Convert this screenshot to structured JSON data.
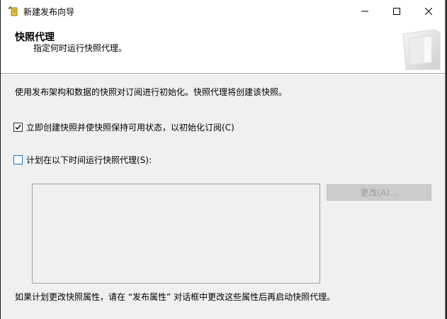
{
  "window": {
    "title": "新建发布向导",
    "controls": {
      "minimize_icon": "minimize-icon",
      "maximize_icon": "maximize-icon",
      "close_icon": "close-icon"
    }
  },
  "header": {
    "title": "快照代理",
    "subtitle": "指定何时运行快照代理。"
  },
  "main": {
    "description": "使用发布架构和数据的快照对订阅进行初始化。快照代理将创建该快照。",
    "options": [
      {
        "label": "立即创建快照并使快照保持可用状态，以初始化订阅(C)",
        "checked": true
      },
      {
        "label": "计划在以下时间运行快照代理(S):",
        "checked": false
      }
    ],
    "schedule_box_text": "",
    "change_button_label": "更改(A)...",
    "footer_note": "如果计划更改快照属性，请在 “发布属性” 对话框中更改这些属性后再启动快照代理。"
  },
  "colors": {
    "accent": "#1c6fc5",
    "background": "#f0f0f0",
    "header_bg": "#ffffff",
    "disabled_button": "#cccccc"
  }
}
